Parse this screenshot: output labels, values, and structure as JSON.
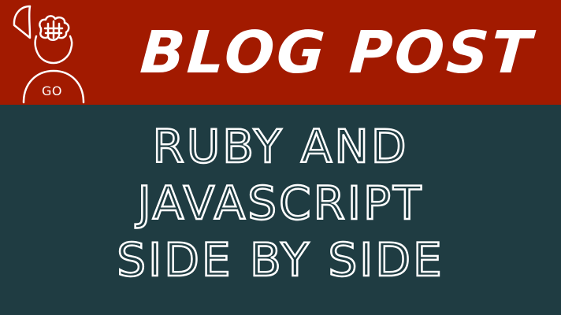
{
  "banner": {
    "logo_text": "GO",
    "headline": "BLOG POST",
    "title_lines": [
      "RUBY AND",
      "JAVASCRIPT",
      "SIDE BY SIDE"
    ]
  },
  "icons": {
    "logo": "open-head-brain-icon"
  },
  "colors": {
    "top_band": "#A21A00",
    "bottom_band": "#1F3C42",
    "text": "#FFFFFF"
  }
}
